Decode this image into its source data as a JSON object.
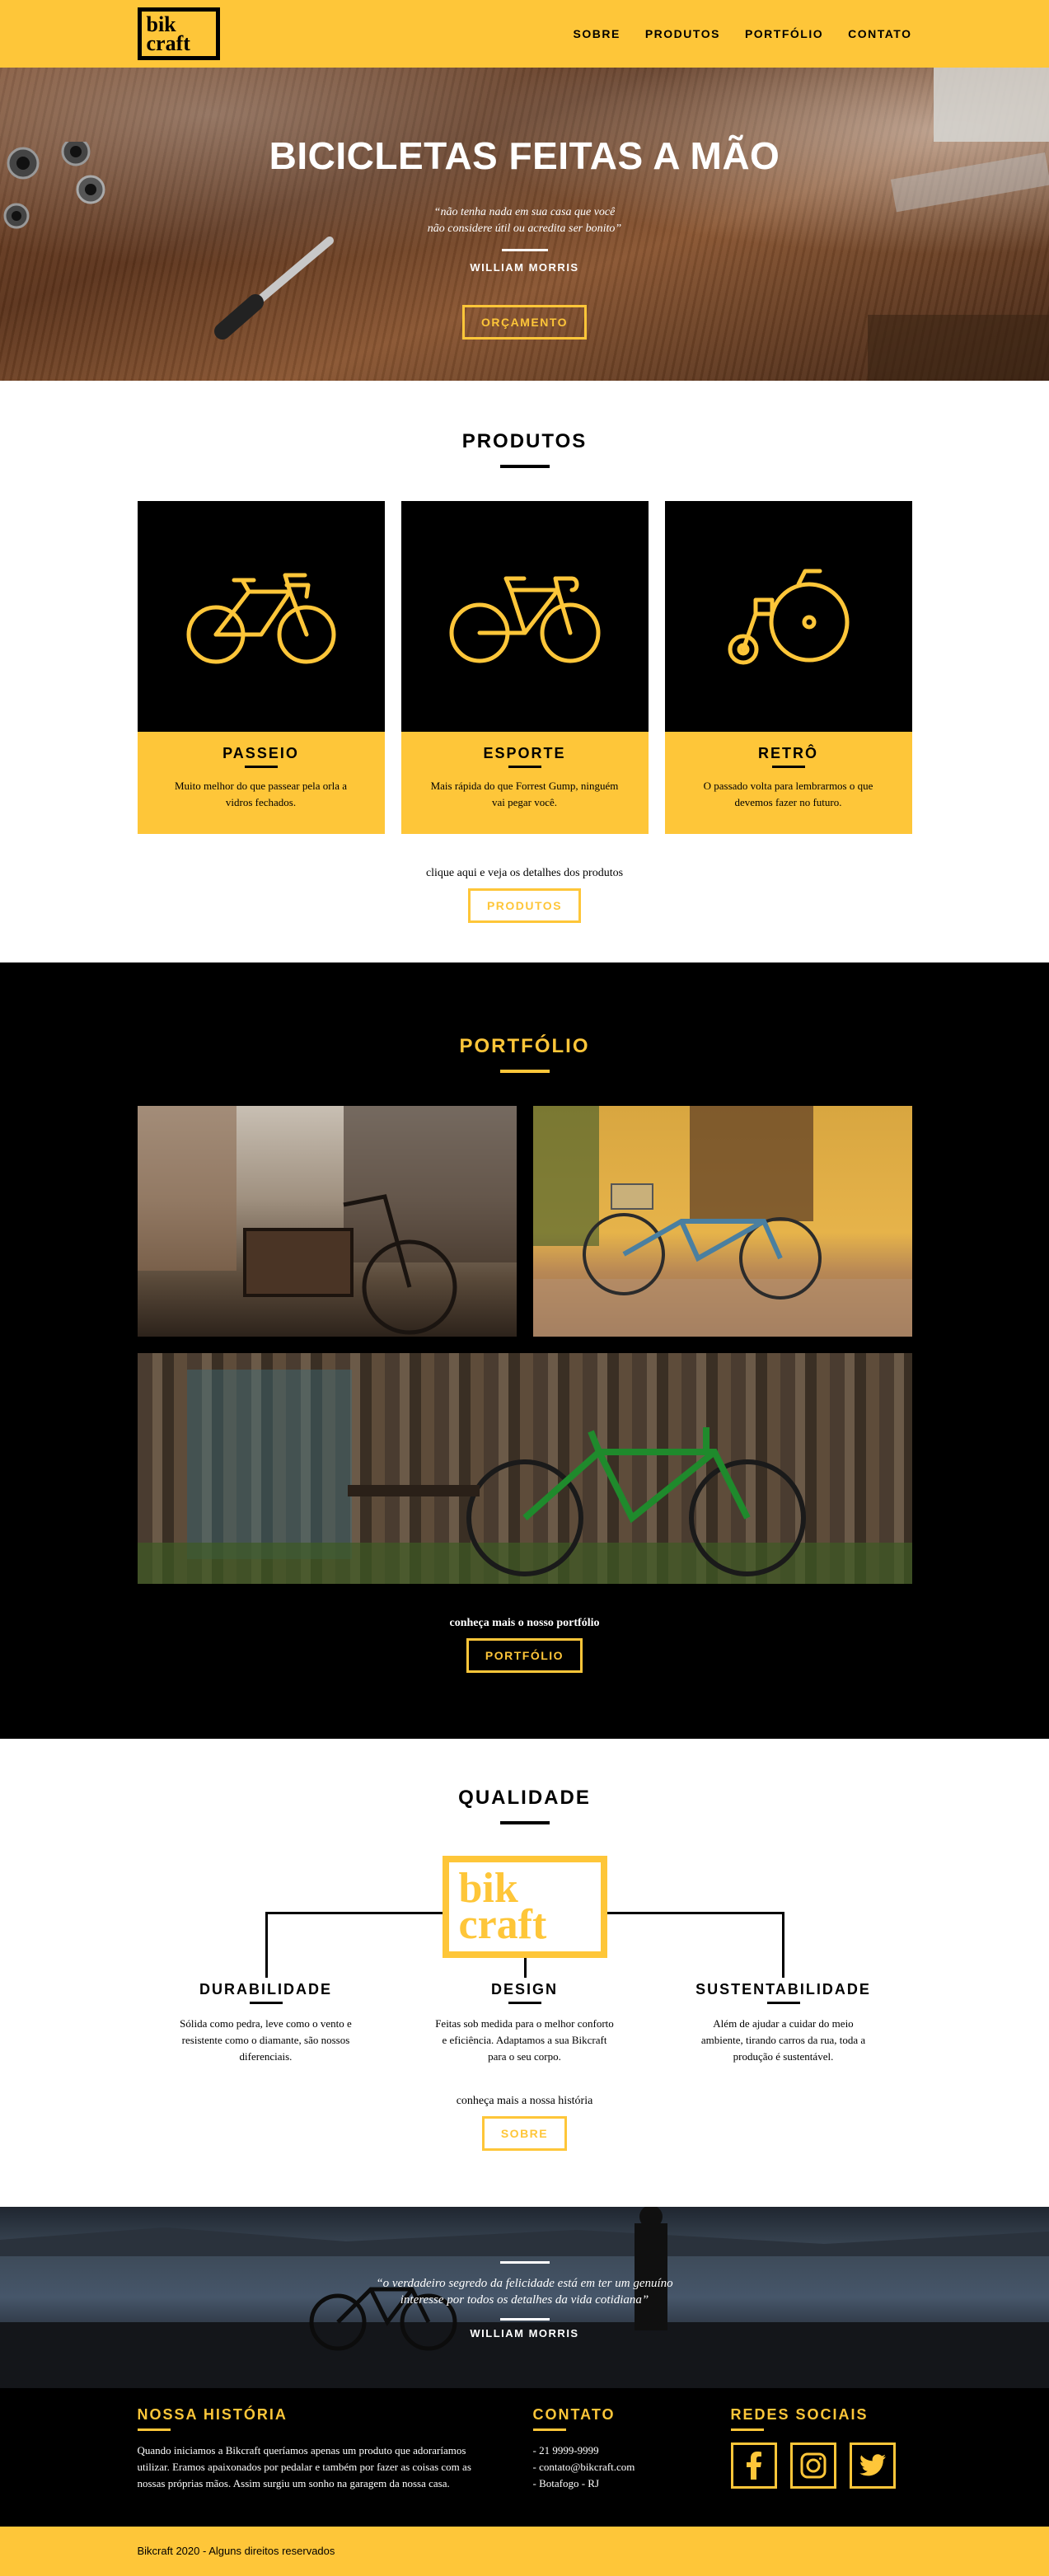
{
  "header": {
    "logo": [
      "bik",
      "craft"
    ],
    "nav": [
      "SOBRE",
      "PRODUTOS",
      "PORTFÓLIO",
      "CONTATO"
    ]
  },
  "hero": {
    "title": "BICICLETAS FEITAS A MÃO",
    "quote_line1": "“não tenha nada em sua casa que você",
    "quote_line2": "não considere útil ou acredita ser bonito”",
    "author": "WILLIAM MORRIS",
    "button": "ORÇAMENTO"
  },
  "produtos": {
    "title": "PRODUTOS",
    "items": [
      {
        "name": "PASSEIO",
        "icon": "city-bike-icon",
        "desc": "Muito melhor do que passear pela orla a vidros fechados."
      },
      {
        "name": "ESPORTE",
        "icon": "road-bike-icon",
        "desc": "Mais rápida do que Forrest Gump, ninguém vai pegar você."
      },
      {
        "name": "RETRÔ",
        "icon": "penny-farthing-icon",
        "desc": "O passado volta para lembrarmos o que devemos fazer no futuro."
      }
    ],
    "cta_text": "clique aqui e veja os detalhes dos produtos",
    "cta_button": "PRODUTOS"
  },
  "portfolio": {
    "title": "PORTFÓLIO",
    "cta_text": "conheça mais o nosso portfólio",
    "cta_button": "PORTFÓLIO"
  },
  "qualidade": {
    "title": "QUALIDADE",
    "logo": [
      "bik",
      "craft"
    ],
    "items": [
      {
        "name": "DURABILIDADE",
        "desc": "Sólida como pedra, leve como o vento e resistente como o diamante, são nossos diferenciais."
      },
      {
        "name": "DESIGN",
        "desc": "Feitas sob medida para o melhor conforto e eficiência. Adaptamos a sua Bikcraft para o seu corpo."
      },
      {
        "name": "SUSTENTABILIDADE",
        "desc": "Além de ajudar a cuidar do meio ambiente, tirando carros da rua, toda a produção é sustentável."
      }
    ],
    "cta_text": "conheça mais a nossa história",
    "cta_button": "SOBRE"
  },
  "quote_banner": {
    "quote": "“o verdadeiro segredo da felicidade está em ter um genuíno interesse por todos os detalhes da vida cotidiana”",
    "author": "WILLIAM MORRIS"
  },
  "footer": {
    "historia_title": "NOSSA HISTÓRIA",
    "historia_text": "Quando iniciamos a Bikcraft queríamos apenas um produto que adoraríamos utilizar. Eramos apaixonados por pedalar e também por fazer as coisas com as nossas próprias mãos. Assim surgiu um sonho na garagem da nossa casa.",
    "contato_title": "CONTATO",
    "contato_items": [
      "- 21 9999-9999",
      "- contato@bikcraft.com",
      "- Botafogo - RJ"
    ],
    "redes_title": "REDES SOCIAIS",
    "social_icons": [
      "facebook-icon",
      "instagram-icon",
      "twitter-icon"
    ],
    "copyright": "Bikcraft 2020 - Alguns direitos reservados"
  },
  "colors": {
    "brand_yellow": "#FEC639",
    "black": "#000000",
    "white": "#FFFFFF"
  }
}
